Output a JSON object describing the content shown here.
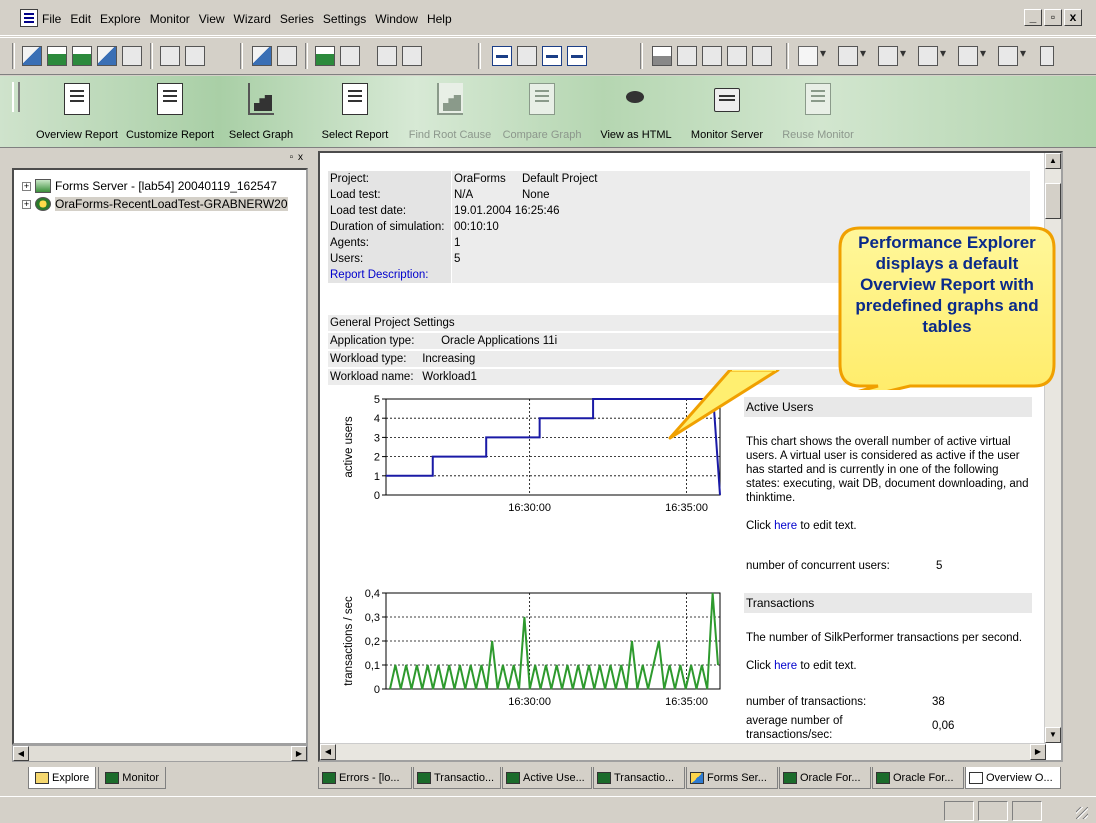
{
  "menu": {
    "items": [
      "File",
      "Edit",
      "Explore",
      "Monitor",
      "View",
      "Wizard",
      "Series",
      "Settings",
      "Window",
      "Help"
    ],
    "window_controls": [
      "_",
      "&#x25A1;",
      "x"
    ]
  },
  "banner": {
    "buttons": [
      {
        "label": "Overview Report",
        "icon": "report-icon",
        "enabled": true
      },
      {
        "label": "Customize Report",
        "icon": "customize-report-icon",
        "enabled": true
      },
      {
        "label": "Select Graph",
        "icon": "select-graph-icon",
        "enabled": true
      },
      {
        "label": "Select Report",
        "icon": "select-report-icon",
        "enabled": true
      },
      {
        "label": "Find Root Cause",
        "icon": "bar-chart-icon",
        "enabled": false
      },
      {
        "label": "Compare Graph",
        "icon": "compare-graph-icon",
        "enabled": false
      },
      {
        "label": "View as HTML",
        "icon": "html-eye-icon",
        "enabled": true
      },
      {
        "label": "Monitor Server",
        "icon": "monitor-icon",
        "enabled": true
      },
      {
        "label": "Reuse Monitor",
        "icon": "reuse-monitor-icon",
        "enabled": false
      }
    ]
  },
  "tree": {
    "items": [
      {
        "label": "Forms Server - [lab54] 20040119_162547",
        "icon": "forms-server-icon"
      },
      {
        "label": "OraForms-RecentLoadTest-GRABNERW20",
        "icon": "oracle-forms-icon"
      }
    ]
  },
  "left_tabs": [
    {
      "label": "Explore",
      "icon": "folder-icon",
      "active": true
    },
    {
      "label": "Monitor",
      "icon": "monitor-icon",
      "active": false
    }
  ],
  "report": {
    "info": [
      {
        "key": "Project:",
        "v1": "OraForms",
        "v2": "Default Project"
      },
      {
        "key": "Load test:",
        "v1": "N/A",
        "v2": "None"
      },
      {
        "key": "Load test date:",
        "v1": "19.01.2004 16:25:46",
        "v2": ""
      },
      {
        "key": "Duration of simulation:",
        "v1": "00:10:10",
        "v2": ""
      },
      {
        "key": "Agents:",
        "v1": "1",
        "v2": ""
      },
      {
        "key": "Users:",
        "v1": "5",
        "v2": ""
      },
      {
        "key": "Report Description:",
        "v1": "",
        "v2": ""
      }
    ],
    "settings_title": "General Project Settings",
    "settings": [
      {
        "key": "Application type:",
        "value": "Oracle Applications 11i"
      },
      {
        "key": "Workload type:",
        "value": "Increasing"
      },
      {
        "key": "Workload name:",
        "value": "Workload1"
      }
    ],
    "active_users": {
      "title": "Active Users",
      "description": "This chart shows the overall number of active virtual users. A virtual user is considered as active if the user has started and is currently in one of the following states: executing, wait DB, document downloading, and thinktime.",
      "click_pre": "Click ",
      "click_link": "here",
      "click_post": " to edit text.",
      "stat_label": "number of concurrent users:",
      "stat_value": "5"
    },
    "transactions": {
      "title": "Transactions",
      "description": "The number of SilkPerformer transactions per second.",
      "click_pre": "Click ",
      "click_link": "here",
      "click_post": " to edit text.",
      "stat1_label": "number of transactions:",
      "stat1_value": "38",
      "stat2_label": "average number of transactions/sec:",
      "stat2_value": "0,06"
    }
  },
  "callout": {
    "text": "Performance Explorer displays a default Overview Report with predefined graphs and tables"
  },
  "doc_tabs": [
    {
      "label": "Errors - [lo...",
      "icon": "monitor-icon",
      "active": false
    },
    {
      "label": "Transactio...",
      "icon": "monitor-icon",
      "active": false
    },
    {
      "label": "Active Use...",
      "icon": "monitor-icon",
      "active": false
    },
    {
      "label": "Transactio...",
      "icon": "monitor-icon",
      "active": false
    },
    {
      "label": "Forms Ser...",
      "icon": "forms-server-icon",
      "active": false
    },
    {
      "label": "Oracle For...",
      "icon": "monitor-icon",
      "active": false
    },
    {
      "label": "Oracle For...",
      "icon": "monitor-icon",
      "active": false
    },
    {
      "label": "Overview O...",
      "icon": "report-icon",
      "active": true
    }
  ],
  "chart_data": [
    {
      "type": "line",
      "ylabel": "active users",
      "xticks": [
        "16:30:00",
        "16:35:00"
      ],
      "ylim": [
        0,
        5
      ],
      "yticks": [
        0,
        1,
        2,
        3,
        4,
        5
      ],
      "color": "#1a1aa6",
      "series": [
        {
          "x": [
            0,
            0.06,
            0.14,
            0.22,
            0.3,
            0.38,
            0.46,
            0.54,
            0.62,
            0.98,
            1.0
          ],
          "values": [
            1,
            1,
            2,
            2,
            3,
            3,
            4,
            4,
            5,
            5,
            0
          ]
        }
      ]
    },
    {
      "type": "line",
      "ylabel": "transactions / sec",
      "xticks": [
        "16:30:00",
        "16:35:00"
      ],
      "ylim": [
        0,
        0.4
      ],
      "yticks": [
        "0",
        "0,1",
        "0,2",
        "0,3",
        "0,4"
      ],
      "color": "#2e9a2e",
      "series": [
        {
          "values": [
            0,
            0.1,
            0,
            0.1,
            0,
            0.1,
            0,
            0.1,
            0,
            0.1,
            0,
            0.1,
            0,
            0.1,
            0,
            0.1,
            0,
            0.1,
            0,
            0.2,
            0,
            0.1,
            0,
            0.1,
            0,
            0.3,
            0,
            0.1,
            0,
            0.1,
            0,
            0.1,
            0,
            0.1,
            0,
            0.1,
            0,
            0.1,
            0,
            0.1,
            0,
            0.1,
            0,
            0.1,
            0,
            0.2,
            0,
            0.1,
            0,
            0.1,
            0.2,
            0,
            0.1,
            0,
            0.1,
            0,
            0.1,
            0,
            0.1,
            0,
            0.4,
            0.1
          ]
        }
      ]
    }
  ]
}
